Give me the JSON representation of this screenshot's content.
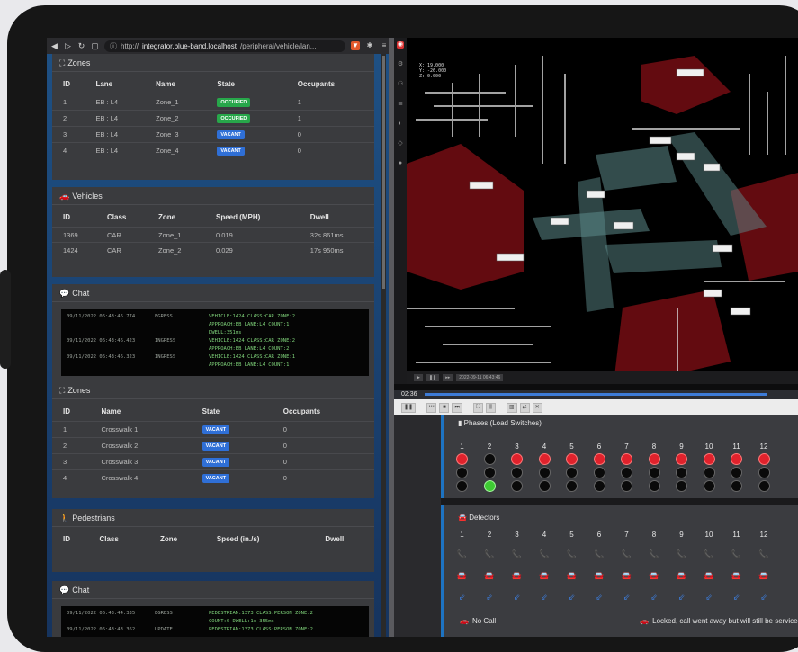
{
  "browser": {
    "url_prefix": "http://",
    "url_host": "integrator.blue-band.localhost",
    "url_path": "/peripheral/vehicle/lan..."
  },
  "zones_vehicle": {
    "title": "Zones",
    "columns": [
      "ID",
      "Lane",
      "Name",
      "State",
      "Occupants"
    ],
    "rows": [
      {
        "id": "1",
        "lane": "EB : L4",
        "name": "Zone_1",
        "state": "OCCUPIED",
        "state_kind": "occupied",
        "occupants": "1"
      },
      {
        "id": "2",
        "lane": "EB : L4",
        "name": "Zone_2",
        "state": "OCCUPIED",
        "state_kind": "occupied",
        "occupants": "1"
      },
      {
        "id": "3",
        "lane": "EB : L4",
        "name": "Zone_3",
        "state": "VACANT",
        "state_kind": "vacant",
        "occupants": "0"
      },
      {
        "id": "4",
        "lane": "EB : L4",
        "name": "Zone_4",
        "state": "VACANT",
        "state_kind": "vacant",
        "occupants": "0"
      }
    ]
  },
  "vehicles": {
    "title": "Vehicles",
    "columns": [
      "ID",
      "Class",
      "Zone",
      "Speed (MPH)",
      "Dwell"
    ],
    "rows": [
      {
        "id": "1369",
        "class": "CAR",
        "zone": "Zone_1",
        "speed": "0.019",
        "dwell": "32s 861ms"
      },
      {
        "id": "1424",
        "class": "CAR",
        "zone": "Zone_2",
        "speed": "0.029",
        "dwell": "17s 950ms"
      }
    ]
  },
  "chat1": {
    "title": "Chat",
    "lines": [
      {
        "ts": "09/11/2022 06:43:46.774",
        "ev": "EGRESS",
        "msg": "VEHICLE:1424 CLASS:CAR ZONE:2"
      },
      {
        "ts": "",
        "ev": "",
        "msg": "APPROACH:EB LANE:L4 COUNT:1"
      },
      {
        "ts": "",
        "ev": "",
        "msg": "DWELL:351ms"
      },
      {
        "ts": "09/11/2022 06:43:46.423",
        "ev": "INGRESS",
        "msg": "VEHICLE:1424 CLASS:CAR ZONE:2"
      },
      {
        "ts": "",
        "ev": "",
        "msg": "APPROACH:EB LANE:L4 COUNT:2"
      },
      {
        "ts": "09/11/2022 06:43:46.323",
        "ev": "INGRESS",
        "msg": "VEHICLE:1424 CLASS:CAR ZONE:1"
      },
      {
        "ts": "",
        "ev": "",
        "msg": "APPROACH:EB LANE:L4 COUNT:1"
      }
    ]
  },
  "zones_ped": {
    "title": "Zones",
    "columns": [
      "ID",
      "Name",
      "State",
      "Occupants"
    ],
    "rows": [
      {
        "id": "1",
        "name": "Crosswalk 1",
        "state": "VACANT",
        "occupants": "0"
      },
      {
        "id": "2",
        "name": "Crosswalk 2",
        "state": "VACANT",
        "occupants": "0"
      },
      {
        "id": "3",
        "name": "Crosswalk 3",
        "state": "VACANT",
        "occupants": "0"
      },
      {
        "id": "4",
        "name": "Crosswalk 4",
        "state": "VACANT",
        "occupants": "0"
      }
    ]
  },
  "pedestrians": {
    "title": "Pedestrians",
    "columns": [
      "ID",
      "Class",
      "Zone",
      "Speed (in./s)",
      "Dwell"
    ]
  },
  "chat2": {
    "title": "Chat",
    "lines": [
      {
        "ts": "09/11/2022 06:43:44.335",
        "ev": "EGRESS",
        "msg": "PEDESTRIAN:1373 CLASS:PERSON ZONE:2"
      },
      {
        "ts": "",
        "ev": "",
        "msg": "COUNT:0 DWELL:1s 355ms"
      },
      {
        "ts": "09/11/2022 06:43:43.362",
        "ev": "UPDATE",
        "msg": "PEDESTRIAN:1373 CLASS:PERSON ZONE:2"
      }
    ]
  },
  "lidar": {
    "info_lines": [
      "X: 19.000",
      "Y: -26.000",
      "Z: 0.000"
    ],
    "player_time": "2022-09-11 06:43:46"
  },
  "timeline": {
    "elapsed": "02:36"
  },
  "phases": {
    "title": "Phases (Load Switches)",
    "numbers": [
      "1",
      "2",
      "3",
      "4",
      "5",
      "6",
      "7",
      "8",
      "9",
      "10",
      "11",
      "12"
    ],
    "states": [
      "red",
      "green",
      "red",
      "red",
      "red",
      "red",
      "red",
      "red",
      "red",
      "red",
      "red",
      "red"
    ]
  },
  "detectors": {
    "title": "Detectors",
    "numbers": [
      "1",
      "2",
      "3",
      "4",
      "5",
      "6",
      "7",
      "8",
      "9",
      "10",
      "11",
      "12"
    ],
    "vehicle_present": [
      true,
      true,
      false,
      false,
      false,
      false,
      false,
      false,
      false,
      false,
      false,
      false
    ],
    "legend_no_call": "No Call",
    "legend_locked": "Locked, call went away but will still be serviced"
  },
  "colors": {
    "occupied": "#27a74a",
    "vacant": "#2f6fd6",
    "phase_red": "#e0222c",
    "phase_green": "#3ecb33",
    "detector_active": "#e5a71d",
    "accent": "#1d73c2"
  }
}
